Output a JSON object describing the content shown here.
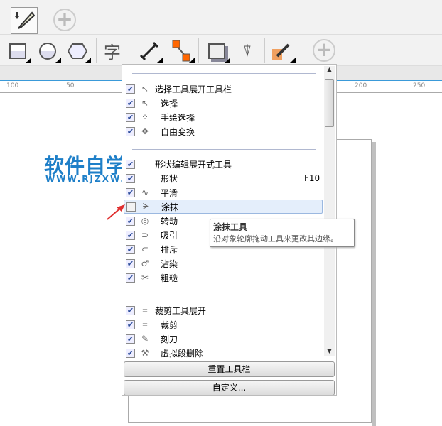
{
  "toolbar_top": {
    "icons": [
      "eyedropper-fill-icon",
      "add-tool-icon"
    ]
  },
  "toolbar_main": {
    "icons": [
      "rectangle-icon",
      "ellipse-icon",
      "polygon-icon",
      "text-icon",
      "dimension-icon",
      "connector-icon",
      "drop-shadow-icon",
      "transparency-icon",
      "color-eyedropper-icon",
      "add-tool-icon"
    ],
    "text_glyph": "字"
  },
  "ruler": {
    "labels": [
      "100",
      "50",
      "200",
      "250"
    ]
  },
  "menu": {
    "groups": [
      {
        "items": [
          {
            "label": "选择工具展开工具栏",
            "checked": true,
            "icon": "pick-icon",
            "header": true
          },
          {
            "label": "选择",
            "checked": true,
            "icon": "pick-icon"
          },
          {
            "label": "手绘选择",
            "checked": true,
            "icon": "freehand-pick-icon"
          },
          {
            "label": "自由变换",
            "checked": true,
            "icon": "free-transform-icon"
          }
        ]
      },
      {
        "items": [
          {
            "label": "形状编辑展开式工具",
            "checked": true,
            "icon": "",
            "header": true
          },
          {
            "label": "形状",
            "checked": true,
            "icon": "shape-icon",
            "shortcut": "F10"
          },
          {
            "label": "平滑",
            "checked": true,
            "icon": "smooth-icon"
          },
          {
            "label": "涂抹",
            "checked": false,
            "icon": "smear-icon",
            "highlighted": true
          },
          {
            "label": "转动",
            "checked": true,
            "icon": "twirl-icon"
          },
          {
            "label": "吸引",
            "checked": true,
            "icon": "attract-icon"
          },
          {
            "label": "排斥",
            "checked": true,
            "icon": "repel-icon"
          },
          {
            "label": "沾染",
            "checked": true,
            "icon": "smudge-icon"
          },
          {
            "label": "粗糙",
            "checked": true,
            "icon": "roughen-icon"
          }
        ]
      },
      {
        "items": [
          {
            "label": "裁剪工具展开",
            "checked": true,
            "icon": "crop-icon",
            "header": true
          },
          {
            "label": "裁剪",
            "checked": true,
            "icon": "crop-icon"
          },
          {
            "label": "刻刀",
            "checked": true,
            "icon": "knife-icon"
          },
          {
            "label": "虚拟段删除",
            "checked": true,
            "icon": "virtual-segment-delete-icon"
          }
        ]
      }
    ],
    "reset_label": "重置工具栏",
    "customize_label": "自定义..."
  },
  "tooltip": {
    "title": "涂抹工具",
    "description": "沿对象轮廓拖动工具来更改其边缘。"
  },
  "watermark": {
    "title": "软件自学网",
    "url": "WWW.RJZXW.COM"
  },
  "colors": {
    "accent": "#1e7fc8",
    "highlight": "#e4eefb",
    "arrow": "#e03030"
  }
}
